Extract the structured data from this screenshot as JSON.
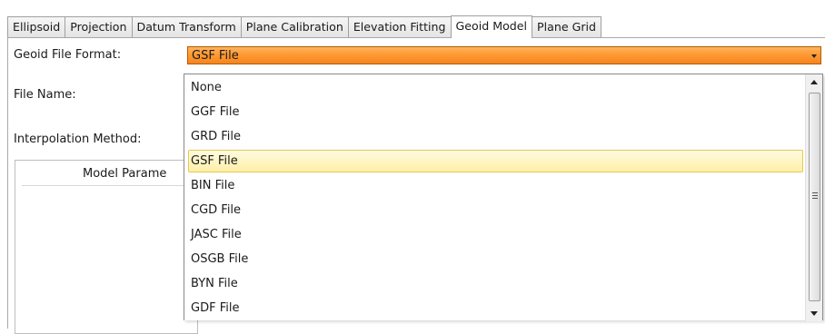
{
  "tabs": [
    {
      "label": "Ellipsoid",
      "active": false
    },
    {
      "label": "Projection",
      "active": false
    },
    {
      "label": "Datum Transform",
      "active": false
    },
    {
      "label": "Plane Calibration",
      "active": false
    },
    {
      "label": "Elevation Fitting",
      "active": false
    },
    {
      "label": "Geoid Model",
      "active": true
    },
    {
      "label": "Plane Grid",
      "active": false
    }
  ],
  "form": {
    "geoid_file_format_label": "Geoid File Format:",
    "file_name_label": "File Name:",
    "interpolation_method_label": "Interpolation Method:",
    "geoid_file_format_value": "GSF File"
  },
  "model_params": {
    "header": "Model Parame"
  },
  "dropdown": {
    "options": [
      "None",
      "GGF File",
      "GRD File",
      "GSF File",
      "BIN File",
      "CGD File",
      "JASC File",
      "OSGB File",
      "BYN File",
      "GDF File"
    ],
    "selected": "GSF File"
  },
  "colors": {
    "combo_accent": "#ff9a32",
    "selected_item_bg": "#ffefa8",
    "selected_item_border": "#e7c84f"
  },
  "icons": {
    "combo_arrow": "chevron-down-icon",
    "scroll_up": "scroll-up-arrow-icon",
    "scroll_down": "scroll-down-arrow-icon"
  }
}
